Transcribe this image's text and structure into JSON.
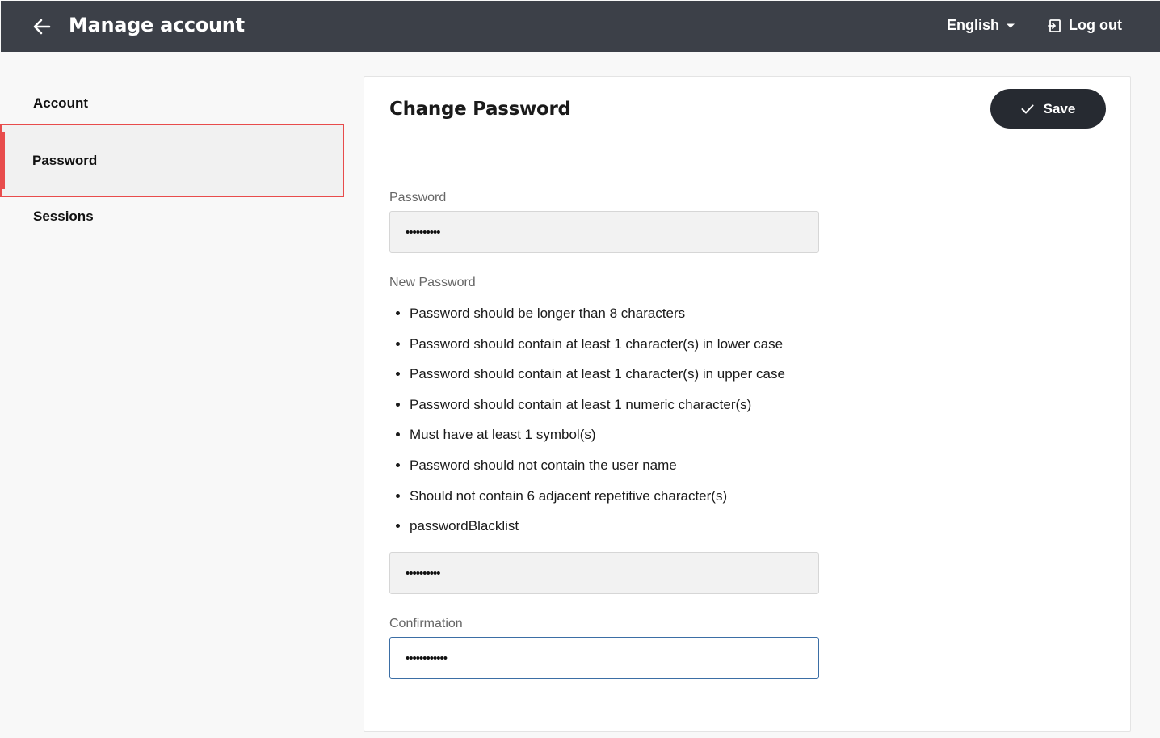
{
  "header": {
    "title": "Manage account",
    "language": "English",
    "logout_label": "Log out"
  },
  "sidebar": {
    "items": [
      {
        "label": "Account"
      },
      {
        "label": "Password"
      },
      {
        "label": "Sessions"
      }
    ]
  },
  "panel": {
    "title": "Change Password",
    "save_label": "Save",
    "current_password": {
      "label": "Password",
      "value": "••••••••••"
    },
    "new_password": {
      "label": "New Password",
      "rules": [
        "Password should be longer than 8 characters",
        "Password should contain at least 1 character(s) in lower case",
        "Password should contain at least 1 character(s) in upper case",
        "Password should contain at least 1 numeric character(s)",
        "Must have at least 1 symbol(s)",
        "Password should not contain the user name",
        "Should not contain 6 adjacent repetitive character(s)",
        "passwordBlacklist"
      ],
      "value": "••••••••••"
    },
    "confirmation": {
      "label": "Confirmation",
      "value": "••••••••••••"
    }
  },
  "colors": {
    "topbar": "#3c4048",
    "active_accent": "#e84c4c",
    "save_button": "#262a31",
    "focus_border": "#3b6ea5"
  }
}
